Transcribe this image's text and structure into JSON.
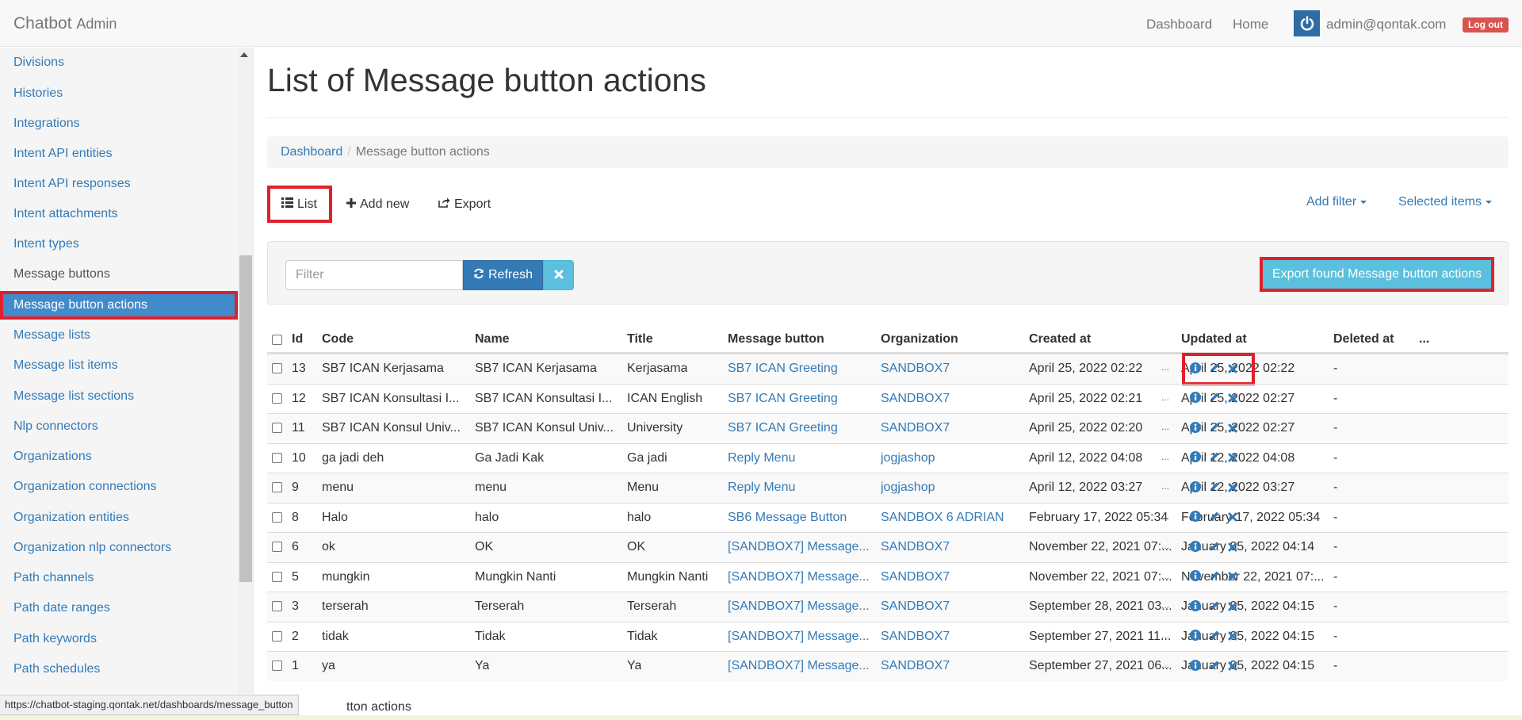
{
  "brand": {
    "name": "Chatbot",
    "suffix": "Admin"
  },
  "nav": {
    "dashboard": "Dashboard",
    "home": "Home",
    "user": "admin@qontak.com",
    "logout": "Log out"
  },
  "sidebar": {
    "items": [
      {
        "label": "Divisions"
      },
      {
        "label": "Histories"
      },
      {
        "label": "Integrations"
      },
      {
        "label": "Intent API entities"
      },
      {
        "label": "Intent API responses"
      },
      {
        "label": "Intent attachments"
      },
      {
        "label": "Intent types"
      },
      {
        "label": "Message buttons"
      },
      {
        "label": "Message button actions"
      },
      {
        "label": "Message lists"
      },
      {
        "label": "Message list items"
      },
      {
        "label": "Message list sections"
      },
      {
        "label": "Nlp connectors"
      },
      {
        "label": "Organizations"
      },
      {
        "label": "Organization connections"
      },
      {
        "label": "Organization entities"
      },
      {
        "label": "Organization nlp connectors"
      },
      {
        "label": "Path channels"
      },
      {
        "label": "Path date ranges"
      },
      {
        "label": "Path keywords"
      },
      {
        "label": "Path schedules"
      }
    ]
  },
  "page": {
    "title": "List of Message button actions"
  },
  "breadcrumb": {
    "root": "Dashboard",
    "current": "Message button actions"
  },
  "tabs": {
    "list": "List",
    "add_new": "Add new",
    "export": "Export",
    "add_filter": "Add filter",
    "selected_items": "Selected items"
  },
  "filter": {
    "placeholder": "Filter",
    "value": "",
    "refresh": "Refresh",
    "export_found": "Export found Message button actions"
  },
  "table": {
    "headers": {
      "id": "Id",
      "code": "Code",
      "name": "Name",
      "title": "Title",
      "message_button": "Message button",
      "organization": "Organization",
      "created_at": "Created at",
      "updated_at": "Updated at",
      "deleted_at": "Deleted at",
      "more": "..."
    },
    "rows": [
      {
        "id": "13",
        "code": "SB7 ICAN Kerjasama",
        "name": "SB7 ICAN Kerjasama",
        "title": "Kerjasama",
        "message_button": "SB7 ICAN Greeting",
        "organization": "SANDBOX7",
        "created_at": "April 25, 2022 02:22",
        "updated_at": "April 25, 2022 02:22",
        "deleted_at": "-",
        "more": "..."
      },
      {
        "id": "12",
        "code": "SB7 ICAN Konsultasi I...",
        "name": "SB7 ICAN Konsultasi I...",
        "title": "ICAN English",
        "message_button": "SB7 ICAN Greeting",
        "organization": "SANDBOX7",
        "created_at": "April 25, 2022 02:21",
        "updated_at": "April 25, 2022 02:27",
        "deleted_at": "-",
        "more": "..."
      },
      {
        "id": "11",
        "code": "SB7 ICAN Konsul Univ...",
        "name": "SB7 ICAN Konsul Univ...",
        "title": "University",
        "message_button": "SB7 ICAN Greeting",
        "organization": "SANDBOX7",
        "created_at": "April 25, 2022 02:20",
        "updated_at": "April 25, 2022 02:27",
        "deleted_at": "-",
        "more": "..."
      },
      {
        "id": "10",
        "code": "ga jadi deh",
        "name": "Ga Jadi Kak",
        "title": "Ga jadi",
        "message_button": "Reply Menu",
        "organization": "jogjashop",
        "created_at": "April 12, 2022 04:08",
        "updated_at": "April 12, 2022 04:08",
        "deleted_at": "-",
        "more": "..."
      },
      {
        "id": "9",
        "code": "menu",
        "name": "menu",
        "title": "Menu",
        "message_button": "Reply Menu",
        "organization": "jogjashop",
        "created_at": "April 12, 2022 03:27",
        "updated_at": "April 12, 2022 03:27",
        "deleted_at": "-",
        "more": "..."
      },
      {
        "id": "8",
        "code": "Halo",
        "name": "halo",
        "title": "halo",
        "message_button": "SB6 Message Button",
        "organization": "SANDBOX 6 ADRIAN",
        "created_at": "February 17, 2022 05:34",
        "updated_at": "February 17, 2022 05:34",
        "deleted_at": "-",
        "more": "..."
      },
      {
        "id": "6",
        "code": "ok",
        "name": "OK",
        "title": "OK",
        "message_button": "[SANDBOX7] Message...",
        "organization": "SANDBOX7",
        "created_at": "November 22, 2021 07:...",
        "updated_at": "January 05, 2022 04:14",
        "deleted_at": "-",
        "more": "..."
      },
      {
        "id": "5",
        "code": "mungkin",
        "name": "Mungkin Nanti",
        "title": "Mungkin Nanti",
        "message_button": "[SANDBOX7] Message...",
        "organization": "SANDBOX7",
        "created_at": "November 22, 2021 07:...",
        "updated_at": "November 22, 2021 07:...",
        "deleted_at": "-",
        "more": "..."
      },
      {
        "id": "3",
        "code": "terserah",
        "name": "Terserah",
        "title": "Terserah",
        "message_button": "[SANDBOX7] Message...",
        "organization": "SANDBOX7",
        "created_at": "September 28, 2021 03...",
        "updated_at": "January 05, 2022 04:15",
        "deleted_at": "-",
        "more": "..."
      },
      {
        "id": "2",
        "code": "tidak",
        "name": "Tidak",
        "title": "Tidak",
        "message_button": "[SANDBOX7] Message...",
        "organization": "SANDBOX7",
        "created_at": "September 27, 2021 11...",
        "updated_at": "January 05, 2022 04:15",
        "deleted_at": "-",
        "more": "..."
      },
      {
        "id": "1",
        "code": "ya",
        "name": "Ya",
        "title": "Ya",
        "message_button": "[SANDBOX7] Message...",
        "organization": "SANDBOX7",
        "created_at": "September 27, 2021 06...",
        "updated_at": "January 05, 2022 04:15",
        "deleted_at": "-",
        "more": "..."
      }
    ]
  },
  "footer": {
    "text": "tton actions"
  },
  "status_bar": {
    "url": "https://chatbot-staging.qontak.net/dashboards/message_button"
  },
  "colors": {
    "primary": "#337ab7",
    "info": "#5bc0de",
    "danger": "#d9534f",
    "highlight": "#e0202a"
  },
  "icons": {
    "info": "info-icon",
    "edit": "pencil-icon",
    "delete": "close-icon",
    "list": "list-icon",
    "plus": "plus-icon",
    "export": "share-icon",
    "refresh": "refresh-icon",
    "power": "power-icon"
  }
}
